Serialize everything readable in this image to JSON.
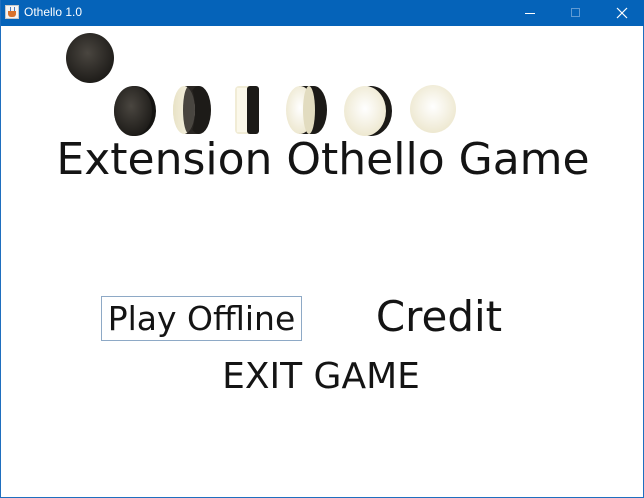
{
  "window": {
    "title": "Othello 1.0",
    "controls": {
      "minimize": "minimize-icon",
      "maximize": "maximize-icon",
      "close": "close-icon"
    }
  },
  "intro": {
    "discs": [
      "black",
      "black",
      "black-turning",
      "edge",
      "white-turning",
      "white",
      "white"
    ],
    "title": "Extension Othello Game"
  },
  "menu": {
    "play_offline": "Play Offline",
    "credit": "Credit",
    "exit_game": "EXIT GAME"
  },
  "colors": {
    "titlebar": "#0563b9",
    "disc_black": "#262421",
    "disc_white": "#f3efd9",
    "text": "#141414",
    "button_border": "#8ea9c6"
  }
}
